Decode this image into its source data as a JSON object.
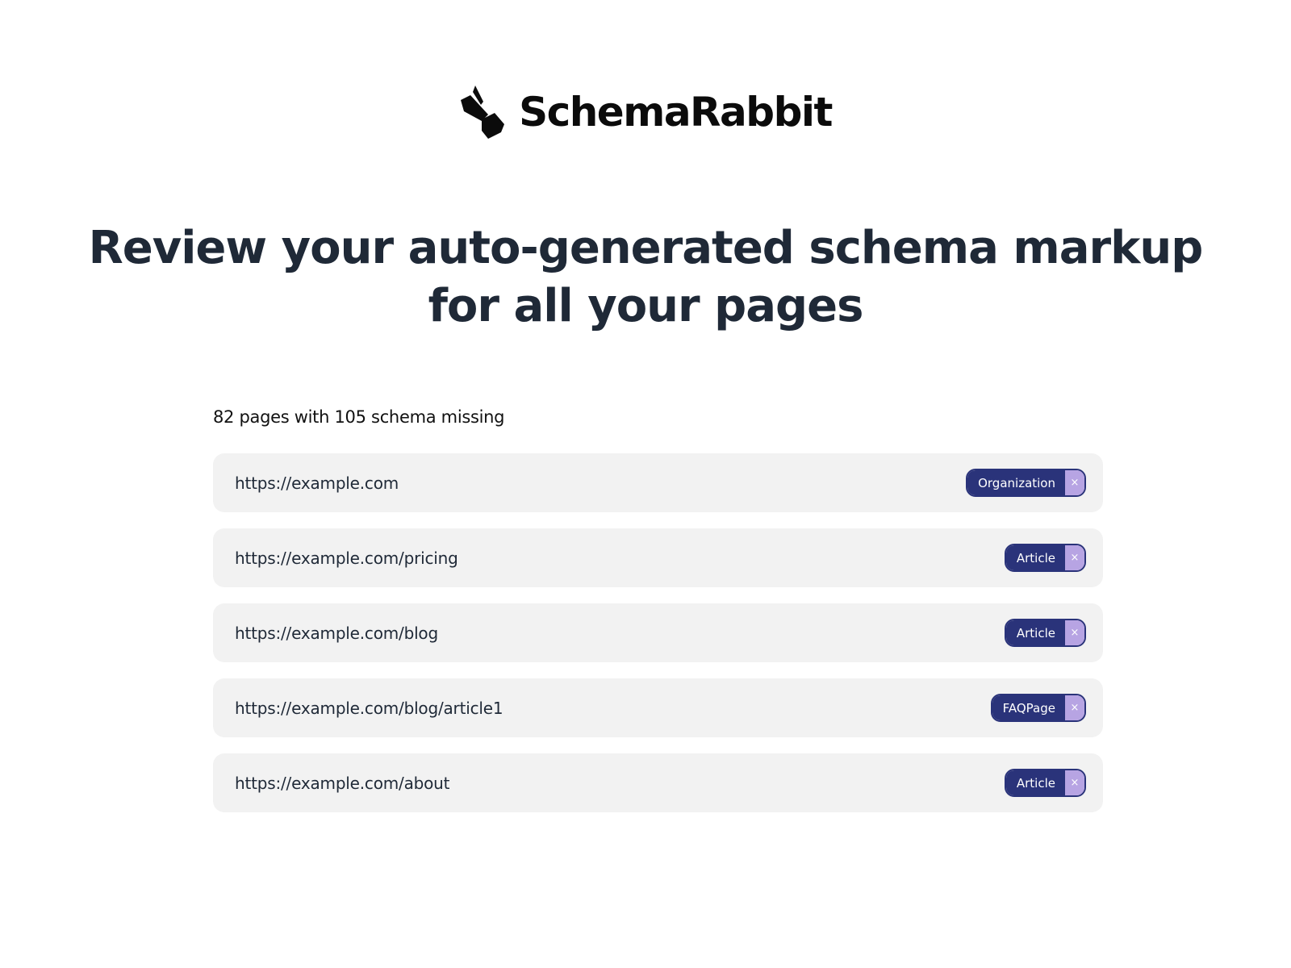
{
  "brand": {
    "name": "SchemaRabbit",
    "logo_icon": "rabbit-logo-icon"
  },
  "headline": {
    "line1": "Review your auto-generated schema markup",
    "line2": "for all your pages"
  },
  "summary": "82 pages with 105 schema missing",
  "colors": {
    "tag_background": "#2a337a",
    "tag_remove_background": "#b7a4e3",
    "row_background": "#f2f2f2",
    "headline": "#1f2937"
  },
  "pages": [
    {
      "url": "https://example.com",
      "schema": "Organization",
      "remove_icon": "×"
    },
    {
      "url": "https://example.com/pricing",
      "schema": "Article",
      "remove_icon": "×"
    },
    {
      "url": "https://example.com/blog",
      "schema": "Article",
      "remove_icon": "×"
    },
    {
      "url": "https://example.com/blog/article1",
      "schema": "FAQPage",
      "remove_icon": "×"
    },
    {
      "url": "https://example.com/about",
      "schema": "Article",
      "remove_icon": "×"
    }
  ]
}
